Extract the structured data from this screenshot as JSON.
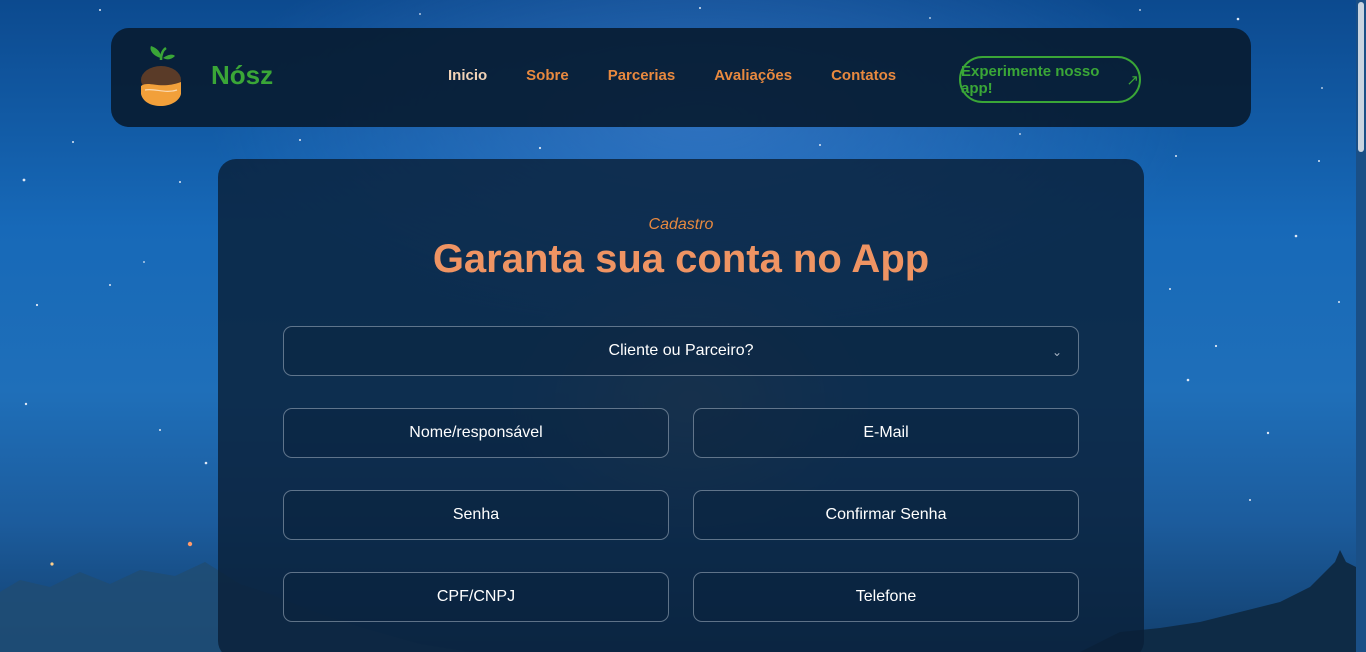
{
  "brand": {
    "name": "Nósz"
  },
  "nav": {
    "links": [
      "Inicio",
      "Sobre",
      "Parcerias",
      "Avaliações",
      "Contatos"
    ],
    "cta_label": "Experimente nosso app!"
  },
  "form": {
    "eyebrow": "Cadastro",
    "title": "Garanta sua conta no App",
    "account_type": {
      "selected": "Cliente ou Parceiro?"
    },
    "fields": {
      "name_placeholder": "Nome/responsável",
      "email_placeholder": "E-Mail",
      "password_placeholder": "Senha",
      "confirm_password_placeholder": "Confirmar Senha",
      "document_placeholder": "CPF/CNPJ",
      "phone_placeholder": "Telefone"
    }
  },
  "colors": {
    "accent_orange": "#e8893f",
    "title_orange": "#ef9463",
    "brand_green": "#3aa637",
    "nav_background": "#081c32"
  }
}
